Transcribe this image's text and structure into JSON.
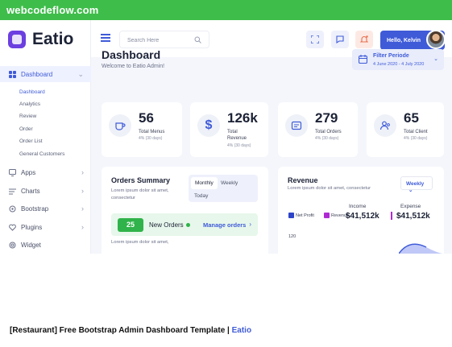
{
  "site_banner": "webcodeflow.com",
  "app": {
    "name": "Eatio"
  },
  "sidebar": {
    "items": [
      {
        "label": "Dashboard",
        "icon": "dashboard-icon",
        "active": true
      },
      {
        "label": "Apps",
        "icon": "apps-icon"
      },
      {
        "label": "Charts",
        "icon": "charts-icon"
      },
      {
        "label": "Bootstrap",
        "icon": "bootstrap-icon"
      },
      {
        "label": "Plugins",
        "icon": "plugins-icon"
      },
      {
        "label": "Widget",
        "icon": "widget-icon"
      }
    ],
    "subitems": [
      "Dashboard",
      "Analytics",
      "Review",
      "Order",
      "Order List",
      "General Customers"
    ]
  },
  "header": {
    "search_placeholder": "Search Here",
    "user_greeting": "Hello, Kelvin"
  },
  "page": {
    "title": "Dashboard",
    "subtitle": "Welcome to Eatio Admin!"
  },
  "filter": {
    "title": "Filter Periode",
    "range": "4 June 2020 - 4 July 2020"
  },
  "stats": [
    {
      "value": "56",
      "label": "Total Menus",
      "sub": "4% (30 days)",
      "icon": "cup-icon"
    },
    {
      "value": "126k",
      "label": "Total Revenue",
      "sub": "4% (30 days)",
      "icon": "dollar-icon"
    },
    {
      "value": "279",
      "label": "Total Orders",
      "sub": "4% (30 days)",
      "icon": "orders-icon"
    },
    {
      "value": "65",
      "label": "Total Client",
      "sub": "4% (30 days)",
      "icon": "client-icon"
    }
  ],
  "orders_summary": {
    "title": "Orders Summary",
    "description": "Lorem ipsum dolor sit amet, consectetur",
    "tabs": [
      "Monthly",
      "Weekly",
      "Today"
    ],
    "new_orders_count": "25",
    "new_orders_label": "New Orders",
    "manage_label": "Manage orders",
    "footer_text": "Lorem ipsum dolor sit amet,"
  },
  "revenue": {
    "title": "Revenue",
    "description": "Lorem ipsum dolor sit amet, consectetur",
    "period": "Weekly",
    "legend": [
      {
        "name": "Net Profit",
        "color": "#2e44c9"
      },
      {
        "name": "Revenue",
        "color": "#b02ad4"
      }
    ],
    "income_label": "Income",
    "income_value": "$41,512k",
    "expense_label": "Expense",
    "expense_value": "$41,512k",
    "axis_label": "120"
  },
  "caption": {
    "text": "[Restaurant] Free Bootstrap Admin Dashboard Template | ",
    "brand": "Eatio"
  },
  "colors": {
    "accent": "#3f5bd8",
    "green": "#3ebd4a"
  }
}
